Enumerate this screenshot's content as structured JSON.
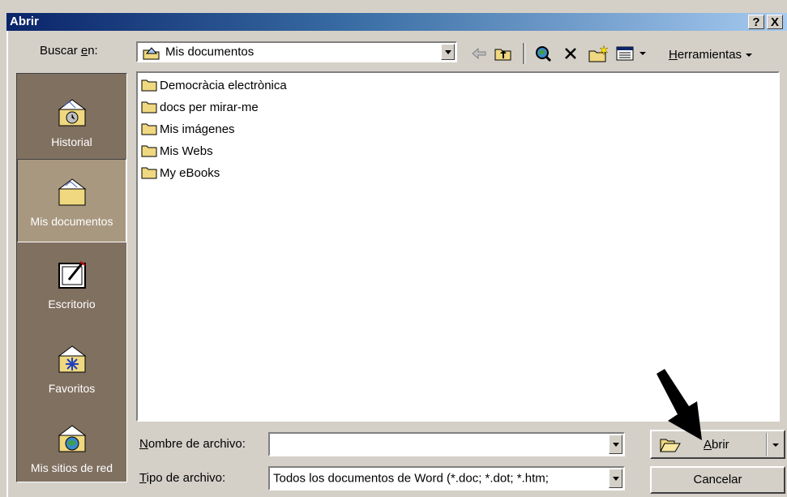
{
  "dialog": {
    "title": "Abrir",
    "help_label": "?",
    "close_label": "X"
  },
  "lookin": {
    "label_pre": "Buscar ",
    "label_u": "e",
    "label_post": "n:",
    "value": "Mis documentos"
  },
  "toolbar": {
    "tools_u": "H",
    "tools_rest": "erramientas"
  },
  "places": [
    {
      "label": "Historial",
      "icon": "history-folder-icon"
    },
    {
      "label": "Mis documentos",
      "icon": "my-documents-icon",
      "selected": true
    },
    {
      "label": "Escritorio",
      "icon": "desktop-icon"
    },
    {
      "label": "Favoritos",
      "icon": "favorites-icon"
    },
    {
      "label": "Mis sitios de red",
      "icon": "network-places-icon"
    }
  ],
  "files": [
    "Democràcia electrònica",
    "docs per mirar-me",
    "Mis imágenes",
    "Mis Webs",
    "My eBooks"
  ],
  "filename": {
    "label_u": "N",
    "label_rest": "ombre de archivo:",
    "value": ""
  },
  "filetype": {
    "label_u": "T",
    "label_rest": "ipo de archivo:",
    "value": "Todos los documentos de Word (*.doc; *.dot; *.htm;"
  },
  "buttons": {
    "open_u": "A",
    "open_rest": "brir",
    "cancel": "Cancelar"
  }
}
